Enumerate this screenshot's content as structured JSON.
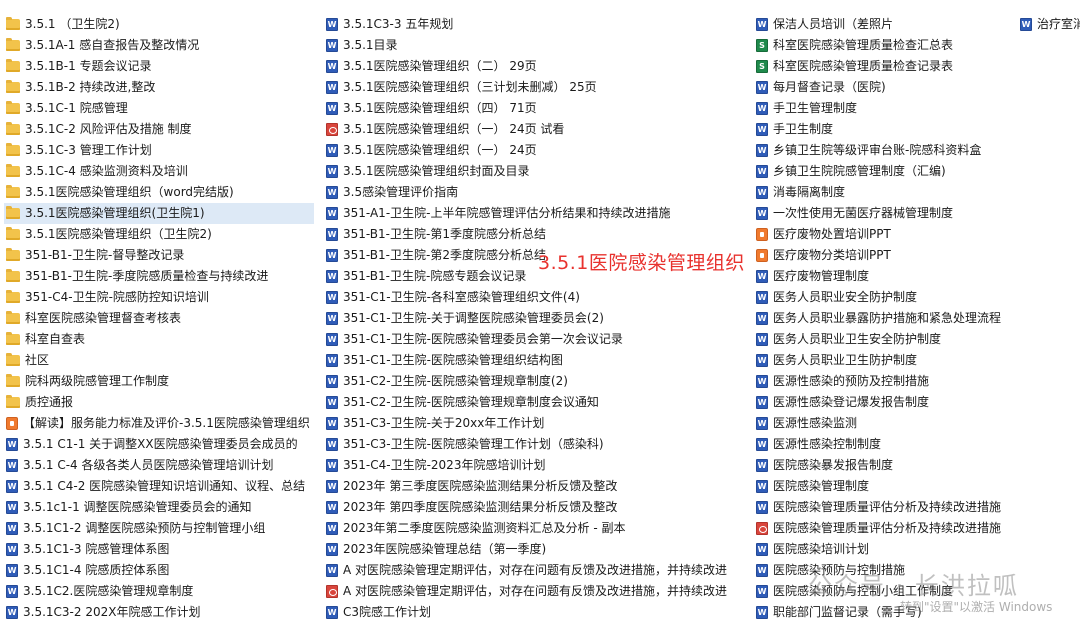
{
  "columns": [
    {
      "items": [
        {
          "icon": "folder",
          "label": "3.5.1 （卫生院2)"
        },
        {
          "icon": "folder",
          "label": "3.5.1A-1 感自查报告及整改情况"
        },
        {
          "icon": "folder",
          "label": "3.5.1B-1 专题会议记录"
        },
        {
          "icon": "folder",
          "label": "3.5.1B-2 持续改进,整改"
        },
        {
          "icon": "folder",
          "label": "3.5.1C-1 院感管理"
        },
        {
          "icon": "folder",
          "label": "3.5.1C-2 风险评估及措施 制度"
        },
        {
          "icon": "folder",
          "label": "3.5.1C-3 管理工作计划"
        },
        {
          "icon": "folder",
          "label": "3.5.1C-4 感染监测资料及培训"
        },
        {
          "icon": "folder",
          "label": "3.5.1医院感染管理组织（word完结版)"
        },
        {
          "icon": "folder",
          "label": "3.5.1医院感染管理组织(卫生院1)"
        },
        {
          "icon": "folder",
          "label": "3.5.1医院感染管理组织（卫生院2)"
        },
        {
          "icon": "folder",
          "label": "351-B1-卫生院-督导整改记录"
        },
        {
          "icon": "folder",
          "label": "351-B1-卫生院-季度院感质量检查与持续改进"
        },
        {
          "icon": "folder",
          "label": "351-C4-卫生院-院感防控知识培训"
        },
        {
          "icon": "folder",
          "label": "科室医院感染管理督查考核表"
        },
        {
          "icon": "folder",
          "label": "科室自查表"
        },
        {
          "icon": "folder",
          "label": "社区"
        },
        {
          "icon": "folder",
          "label": "院科两级院感管理工作制度"
        },
        {
          "icon": "folder",
          "label": "质控通报"
        },
        {
          "icon": "ppt",
          "label": "【解读】服务能力标准及评价-3.5.1医院感染管理组织"
        },
        {
          "icon": "word",
          "label": "3.5.1 C1-1 关于调整XX医院感染管理委员会成员的"
        },
        {
          "icon": "word",
          "label": "3.5.1 C-4  各级各类人员医院感染管理培训计划"
        },
        {
          "icon": "word",
          "label": "3.5.1 C4-2 医院感染管理知识培训通知、议程、总结"
        },
        {
          "icon": "word",
          "label": "3.5.1c1-1   调整医院感染管理委员会的通知"
        },
        {
          "icon": "word",
          "label": "3.5.1C1-2   调整医院感染预防与控制管理小组"
        },
        {
          "icon": "word",
          "label": "3.5.1C1-3     院感管理体系图"
        },
        {
          "icon": "word",
          "label": "3.5.1C1-4     院感质控体系图"
        },
        {
          "icon": "word",
          "label": "3.5.1C2.医院感染管理规章制度"
        },
        {
          "icon": "word",
          "label": "3.5.1C3-2   202X年院感工作计划"
        }
      ]
    },
    {
      "items": [
        {
          "icon": "word",
          "label": "3.5.1C3-3    五年规划"
        },
        {
          "icon": "word",
          "label": "3.5.1目录"
        },
        {
          "icon": "word",
          "label": "3.5.1医院感染管理组织（二） 29页"
        },
        {
          "icon": "word",
          "label": "3.5.1医院感染管理组织（三计划未删减） 25页"
        },
        {
          "icon": "word",
          "label": "3.5.1医院感染管理组织（四） 71页"
        },
        {
          "icon": "pdf",
          "label": "3.5.1医院感染管理组织（一） 24页 试看"
        },
        {
          "icon": "word",
          "label": "3.5.1医院感染管理组织（一） 24页"
        },
        {
          "icon": "word",
          "label": "3.5.1医院感染管理组织封面及目录"
        },
        {
          "icon": "word",
          "label": "3.5感染管理评价指南"
        },
        {
          "icon": "word",
          "label": "351-A1-卫生院-上半年院感管理评估分析结果和持续改进措施"
        },
        {
          "icon": "word",
          "label": "351-B1-卫生院-第1季度院感分析总结"
        },
        {
          "icon": "word",
          "label": "351-B1-卫生院-第2季度院感分析总结"
        },
        {
          "icon": "word",
          "label": "351-B1-卫生院-院感专题会议记录"
        },
        {
          "icon": "word",
          "label": "351-C1-卫生院-各科室感染管理组织文件(4)"
        },
        {
          "icon": "word",
          "label": "351-C1-卫生院-关于调整医院感染管理委员会(2)"
        },
        {
          "icon": "word",
          "label": "351-C1-卫生院-医院感染管理委员会第一次会议记录"
        },
        {
          "icon": "word",
          "label": "351-C1-卫生院-医院感染管理组织结构图"
        },
        {
          "icon": "word",
          "label": "351-C2-卫生院-医院感染管理规章制度(2)"
        },
        {
          "icon": "word",
          "label": "351-C2-卫生院-医院感染管理规章制度会议通知"
        },
        {
          "icon": "word",
          "label": "351-C3-卫生院-关于20xx年工作计划"
        },
        {
          "icon": "word",
          "label": "351-C3-卫生院-医院感染管理工作计划（感染科)"
        },
        {
          "icon": "word",
          "label": "351-C4-卫生院-2023年院感培训计划"
        },
        {
          "icon": "word",
          "label": "2023年 第三季度医院感染监测结果分析反馈及整改"
        },
        {
          "icon": "word",
          "label": "2023年 第四季度医院感染监测结果分析反馈及整改"
        },
        {
          "icon": "word",
          "label": "2023年第二季度医院感染监测资料汇总及分析 - 副本"
        },
        {
          "icon": "word",
          "label": "2023年医院感染管理总结（第一季度)"
        },
        {
          "icon": "word",
          "label": "A  对医院感染管理定期评估，对存在问题有反馈及改进措施，并持续改进"
        },
        {
          "icon": "pdf",
          "label": "A  对医院感染管理定期评估，对存在问题有反馈及改进措施，并持续改进"
        },
        {
          "icon": "word",
          "label": "C3院感工作计划"
        }
      ]
    },
    {
      "items": [
        {
          "icon": "word",
          "label": "保洁人员培训（差照片"
        },
        {
          "icon": "excel",
          "label": "科室医院感染管理质量检查汇总表"
        },
        {
          "icon": "excel",
          "label": "科室医院感染管理质量检查记录表"
        },
        {
          "icon": "word",
          "label": "每月督查记录（医院)"
        },
        {
          "icon": "word",
          "label": "手卫生管理制度"
        },
        {
          "icon": "word",
          "label": "手卫生制度"
        },
        {
          "icon": "word",
          "label": "乡镇卫生院等级评审台账-院感科资料盒"
        },
        {
          "icon": "word",
          "label": "乡镇卫生院院感管理制度（汇编)"
        },
        {
          "icon": "word",
          "label": "消毒隔离制度"
        },
        {
          "icon": "word",
          "label": "一次性使用无菌医疗器械管理制度"
        },
        {
          "icon": "ppt",
          "label": "医疗废物处置培训PPT"
        },
        {
          "icon": "ppt",
          "label": "医疗废物分类培训PPT"
        },
        {
          "icon": "word",
          "label": "医疗废物管理制度"
        },
        {
          "icon": "word",
          "label": "医务人员职业安全防护制度"
        },
        {
          "icon": "word",
          "label": "医务人员职业暴露防护措施和紧急处理流程"
        },
        {
          "icon": "word",
          "label": "医务人员职业卫生安全防护制度"
        },
        {
          "icon": "word",
          "label": "医务人员职业卫生防护制度"
        },
        {
          "icon": "word",
          "label": "医源性感染的预防及控制措施"
        },
        {
          "icon": "word",
          "label": "医源性感染登记爆发报告制度"
        },
        {
          "icon": "word",
          "label": "医源性感染监测"
        },
        {
          "icon": "word",
          "label": "医源性感染控制制度"
        },
        {
          "icon": "word",
          "label": "医院感染暴发报告制度"
        },
        {
          "icon": "word",
          "label": "医院感染管理制度"
        },
        {
          "icon": "word",
          "label": "医院感染管理质量评估分析及持续改进措施"
        },
        {
          "icon": "pdf",
          "label": "医院感染管理质量评估分析及持续改进措施"
        },
        {
          "icon": "word",
          "label": "医院感染培训计划"
        },
        {
          "icon": "word",
          "label": "医院感染预防与控制措施"
        },
        {
          "icon": "word",
          "label": "医院感染预防与控制小组工作制度"
        },
        {
          "icon": "word",
          "label": "职能部门监督记录（需手写)"
        }
      ]
    },
    {
      "items": [
        {
          "icon": "word",
          "label": "治疗室消"
        }
      ]
    }
  ],
  "selected": {
    "column": 0,
    "index": 9
  },
  "overlay_title": "3.5.1医院感染管理组织",
  "watermark": "公众号 · 长洪拉呱",
  "watermark_sub": "转到\"设置\"以激活 Windows",
  "colors": {
    "selection": "#dde9f6",
    "overlay_title": "#e8322e",
    "folder": "#f2c34b",
    "word": "#2f5cb8",
    "excel": "#1f8a4c",
    "pdf": "#d9453c",
    "ppt": "#f07a2e"
  }
}
